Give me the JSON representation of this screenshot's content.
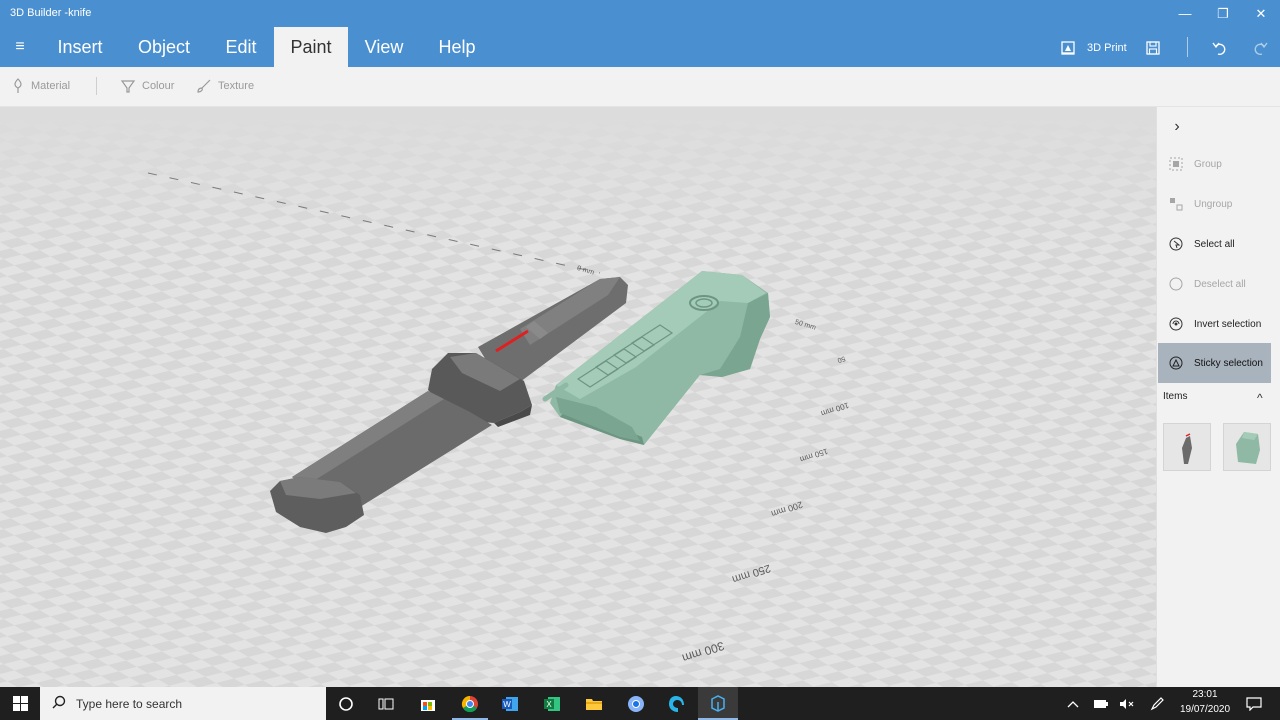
{
  "window": {
    "title": "3D Builder -knife",
    "minimize_glyph": "—",
    "maximize_glyph": "❐",
    "close_glyph": "✕"
  },
  "menu": {
    "hamburger_glyph": "≡",
    "items": [
      "Insert",
      "Object",
      "Edit",
      "Paint",
      "View",
      "Help"
    ],
    "active": "Paint"
  },
  "header_actions": {
    "print_label": "3D Print",
    "save_icon": "save-icon",
    "undo_icon": "undo-icon",
    "redo_icon": "redo-icon"
  },
  "toolbar": {
    "material_label": "Material",
    "colour_label": "Colour",
    "texture_label": "Texture"
  },
  "scene": {
    "ruler_labels": [
      "0 mm",
      "50 mm",
      "50",
      "100 mm",
      "150 mm",
      "200 mm",
      "250 mm",
      "300 mm"
    ],
    "knife_color": "#6b6b6b",
    "sheath_color": "#8fb9a4",
    "highlight_color": "#e02020"
  },
  "panel": {
    "collapse_glyph": "›",
    "actions": [
      {
        "label": "Group",
        "state": "disabled"
      },
      {
        "label": "Ungroup",
        "state": "disabled"
      },
      {
        "label": "Select all",
        "state": "enabled"
      },
      {
        "label": "Deselect all",
        "state": "disabled"
      },
      {
        "label": "Invert selection",
        "state": "enabled"
      },
      {
        "label": "Sticky selection",
        "state": "selected"
      }
    ],
    "items_label": "Items",
    "items_chevron": "^"
  },
  "taskbar": {
    "search_placeholder": "Type here to search",
    "time": "23:01",
    "date": "19/07/2020",
    "pinned_apps": [
      "chrome",
      "word",
      "excel",
      "file-explorer",
      "chromium",
      "edge",
      "3d-builder"
    ]
  },
  "colors": {
    "accent": "#4a90d0",
    "taskbar": "#1f1f1f",
    "panel_selected": "#a9b3bd"
  }
}
